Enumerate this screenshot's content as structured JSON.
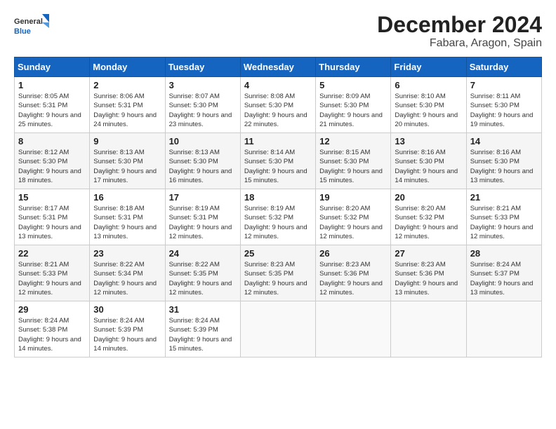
{
  "logo": {
    "general": "General",
    "blue": "Blue"
  },
  "header": {
    "title": "December 2024",
    "subtitle": "Fabara, Aragon, Spain"
  },
  "weekdays": [
    "Sunday",
    "Monday",
    "Tuesday",
    "Wednesday",
    "Thursday",
    "Friday",
    "Saturday"
  ],
  "weeks": [
    [
      {
        "day": "1",
        "sunrise": "8:05 AM",
        "sunset": "5:31 PM",
        "daylight": "9 hours and 25 minutes."
      },
      {
        "day": "2",
        "sunrise": "8:06 AM",
        "sunset": "5:31 PM",
        "daylight": "9 hours and 24 minutes."
      },
      {
        "day": "3",
        "sunrise": "8:07 AM",
        "sunset": "5:30 PM",
        "daylight": "9 hours and 23 minutes."
      },
      {
        "day": "4",
        "sunrise": "8:08 AM",
        "sunset": "5:30 PM",
        "daylight": "9 hours and 22 minutes."
      },
      {
        "day": "5",
        "sunrise": "8:09 AM",
        "sunset": "5:30 PM",
        "daylight": "9 hours and 21 minutes."
      },
      {
        "day": "6",
        "sunrise": "8:10 AM",
        "sunset": "5:30 PM",
        "daylight": "9 hours and 20 minutes."
      },
      {
        "day": "7",
        "sunrise": "8:11 AM",
        "sunset": "5:30 PM",
        "daylight": "9 hours and 19 minutes."
      }
    ],
    [
      {
        "day": "8",
        "sunrise": "8:12 AM",
        "sunset": "5:30 PM",
        "daylight": "9 hours and 18 minutes."
      },
      {
        "day": "9",
        "sunrise": "8:13 AM",
        "sunset": "5:30 PM",
        "daylight": "9 hours and 17 minutes."
      },
      {
        "day": "10",
        "sunrise": "8:13 AM",
        "sunset": "5:30 PM",
        "daylight": "9 hours and 16 minutes."
      },
      {
        "day": "11",
        "sunrise": "8:14 AM",
        "sunset": "5:30 PM",
        "daylight": "9 hours and 15 minutes."
      },
      {
        "day": "12",
        "sunrise": "8:15 AM",
        "sunset": "5:30 PM",
        "daylight": "9 hours and 15 minutes."
      },
      {
        "day": "13",
        "sunrise": "8:16 AM",
        "sunset": "5:30 PM",
        "daylight": "9 hours and 14 minutes."
      },
      {
        "day": "14",
        "sunrise": "8:16 AM",
        "sunset": "5:30 PM",
        "daylight": "9 hours and 13 minutes."
      }
    ],
    [
      {
        "day": "15",
        "sunrise": "8:17 AM",
        "sunset": "5:31 PM",
        "daylight": "9 hours and 13 minutes."
      },
      {
        "day": "16",
        "sunrise": "8:18 AM",
        "sunset": "5:31 PM",
        "daylight": "9 hours and 13 minutes."
      },
      {
        "day": "17",
        "sunrise": "8:19 AM",
        "sunset": "5:31 PM",
        "daylight": "9 hours and 12 minutes."
      },
      {
        "day": "18",
        "sunrise": "8:19 AM",
        "sunset": "5:32 PM",
        "daylight": "9 hours and 12 minutes."
      },
      {
        "day": "19",
        "sunrise": "8:20 AM",
        "sunset": "5:32 PM",
        "daylight": "9 hours and 12 minutes."
      },
      {
        "day": "20",
        "sunrise": "8:20 AM",
        "sunset": "5:32 PM",
        "daylight": "9 hours and 12 minutes."
      },
      {
        "day": "21",
        "sunrise": "8:21 AM",
        "sunset": "5:33 PM",
        "daylight": "9 hours and 12 minutes."
      }
    ],
    [
      {
        "day": "22",
        "sunrise": "8:21 AM",
        "sunset": "5:33 PM",
        "daylight": "9 hours and 12 minutes."
      },
      {
        "day": "23",
        "sunrise": "8:22 AM",
        "sunset": "5:34 PM",
        "daylight": "9 hours and 12 minutes."
      },
      {
        "day": "24",
        "sunrise": "8:22 AM",
        "sunset": "5:35 PM",
        "daylight": "9 hours and 12 minutes."
      },
      {
        "day": "25",
        "sunrise": "8:23 AM",
        "sunset": "5:35 PM",
        "daylight": "9 hours and 12 minutes."
      },
      {
        "day": "26",
        "sunrise": "8:23 AM",
        "sunset": "5:36 PM",
        "daylight": "9 hours and 12 minutes."
      },
      {
        "day": "27",
        "sunrise": "8:23 AM",
        "sunset": "5:36 PM",
        "daylight": "9 hours and 13 minutes."
      },
      {
        "day": "28",
        "sunrise": "8:24 AM",
        "sunset": "5:37 PM",
        "daylight": "9 hours and 13 minutes."
      }
    ],
    [
      {
        "day": "29",
        "sunrise": "8:24 AM",
        "sunset": "5:38 PM",
        "daylight": "9 hours and 14 minutes."
      },
      {
        "day": "30",
        "sunrise": "8:24 AM",
        "sunset": "5:39 PM",
        "daylight": "9 hours and 14 minutes."
      },
      {
        "day": "31",
        "sunrise": "8:24 AM",
        "sunset": "5:39 PM",
        "daylight": "9 hours and 15 minutes."
      },
      null,
      null,
      null,
      null
    ]
  ]
}
